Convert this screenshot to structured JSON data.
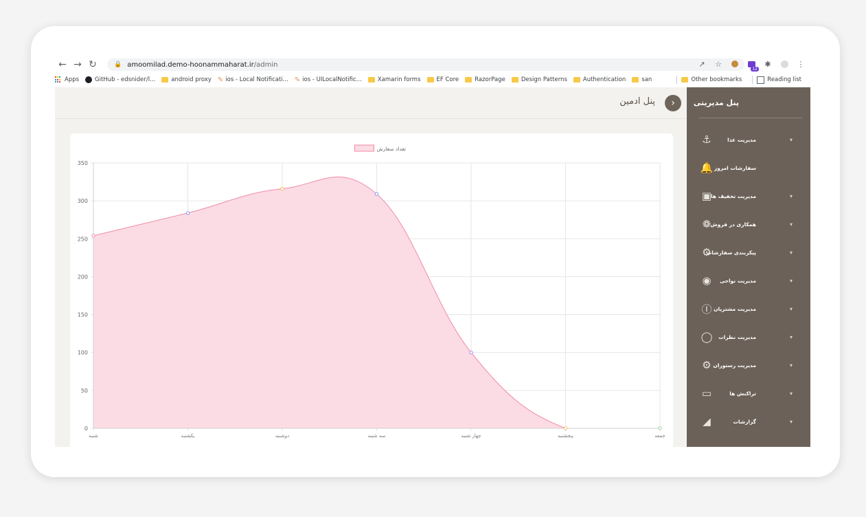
{
  "browser": {
    "url_host": "amoomilad.demo-hoonammaharat.ir",
    "url_path": "/admin",
    "extension_badge": "12"
  },
  "bookmarks": {
    "items": [
      {
        "label": "Apps",
        "icon": "apps-icon"
      },
      {
        "label": "GitHub - edsnider/l...",
        "icon": "github-icon"
      },
      {
        "label": "android proxy",
        "icon": "folder-icon"
      },
      {
        "label": "ios - Local Notificati...",
        "icon": "ios-icon"
      },
      {
        "label": "ios - UILocalNotific...",
        "icon": "ios-icon"
      },
      {
        "label": "Xamarin forms",
        "icon": "folder-icon"
      },
      {
        "label": "EF Core",
        "icon": "folder-icon"
      },
      {
        "label": "RazorPage",
        "icon": "folder-icon"
      },
      {
        "label": "Design Patterns",
        "icon": "folder-icon"
      },
      {
        "label": "Authentication",
        "icon": "folder-icon"
      },
      {
        "label": "san",
        "icon": "folder-icon"
      }
    ],
    "other_bookmarks": "Other bookmarks",
    "reading_list": "Reading list"
  },
  "header": {
    "title": "پنل ادمین"
  },
  "sidebar": {
    "title": "پنل مدیریتی",
    "items": [
      {
        "label": "مدیریت غذا",
        "icon": "utensils-icon",
        "has_submenu": true
      },
      {
        "label": "سفارشات امروز",
        "icon": "bell-icon",
        "has_submenu": false
      },
      {
        "label": "مدیریت تخفیف ها",
        "icon": "discount-icon",
        "has_submenu": true
      },
      {
        "label": "همکاری در فروش",
        "icon": "handshake-icon",
        "has_submenu": true
      },
      {
        "label": "پیکربندی سفارشات",
        "icon": "settings-lightbulb-icon",
        "has_submenu": true
      },
      {
        "label": "مدیریت نواحی",
        "icon": "location-pin-icon",
        "has_submenu": true
      },
      {
        "label": "مدیریت مشتریان",
        "icon": "user-circle-icon",
        "has_submenu": true
      },
      {
        "label": "مدیریت نظرات",
        "icon": "comment-icon",
        "has_submenu": true
      },
      {
        "label": "مدیریت رستوران",
        "icon": "gear-icon",
        "has_submenu": true
      },
      {
        "label": "تراکنش ها",
        "icon": "credit-card-icon",
        "has_submenu": true
      },
      {
        "label": "گزارشات",
        "icon": "area-chart-icon",
        "has_submenu": true
      }
    ]
  },
  "chart_data": {
    "type": "area",
    "legend": [
      "تعداد سفارش"
    ],
    "legend_position": "top",
    "categories": [
      "شنبه",
      "یکشنبه",
      "دوشنبه",
      "سه شنبه",
      "چهار شنبه",
      "پنجشنبه",
      "جمعه"
    ],
    "series": [
      {
        "name": "تعداد سفارش",
        "values": [
          254,
          284,
          316,
          309,
          100,
          0,
          0
        ]
      }
    ],
    "ylim": [
      0,
      350
    ],
    "yticks": [
      0,
      50,
      100,
      150,
      200,
      250,
      300,
      350
    ],
    "grid": true,
    "colors": {
      "fill": "#fcdce4",
      "line": "#f08aa7"
    },
    "point_colors": [
      "#f08aa7",
      "#7a9ee8",
      "#f4b860",
      "#7a9ee8",
      "#b08ae8",
      "#f4b860",
      "#9ccc9c"
    ]
  }
}
